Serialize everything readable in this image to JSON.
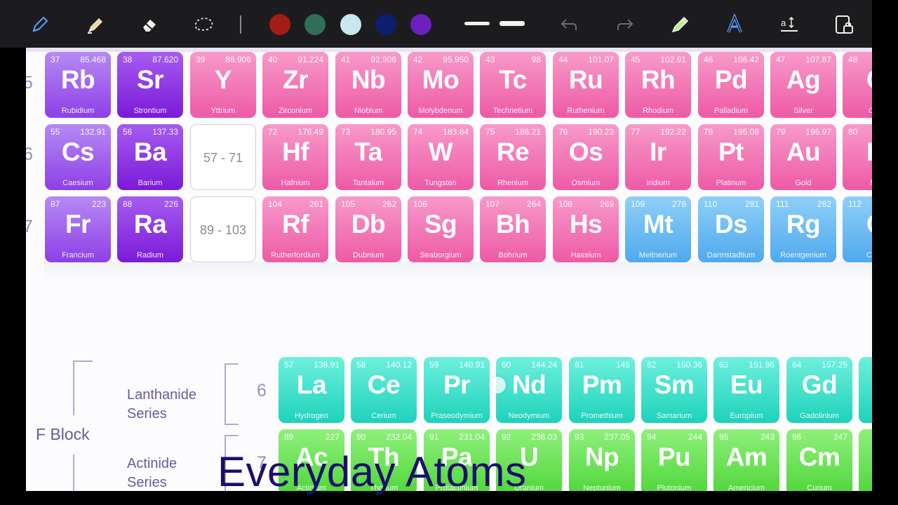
{
  "toolbar": {
    "tools": [
      "pen-icon",
      "highlighter-icon",
      "eraser-icon",
      "lasso-icon"
    ],
    "colors": [
      "#a31c16",
      "#2f6e58",
      "#c9e7f3",
      "#0b1f6e",
      "#6b1fbf"
    ],
    "right_tools": [
      "undo-icon",
      "redo-icon",
      "pencil-icon",
      "text-style-icon",
      "text-size-icon",
      "lock-icon"
    ]
  },
  "periods": {
    "p5": "5",
    "p6": "6",
    "p7": "7",
    "p6f": "6",
    "p7f": "7"
  },
  "labels": {
    "lanthanide": [
      "Lanthanide",
      "Series"
    ],
    "actinide": [
      "Actinide",
      "Series"
    ],
    "fblock": "F Block"
  },
  "rows": [
    [
      {
        "n": "37",
        "m": "85.468",
        "s": "Rb",
        "name": "Rubidium",
        "c": "purple1"
      },
      {
        "n": "38",
        "m": "87.620",
        "s": "Sr",
        "name": "Strontium",
        "c": "purple2"
      },
      {
        "n": "39",
        "m": "88.906",
        "s": "Y",
        "name": "Yttrium",
        "c": "pink"
      },
      {
        "n": "40",
        "m": "91.224",
        "s": "Zr",
        "name": "Zirconium",
        "c": "pink"
      },
      {
        "n": "41",
        "m": "92.906",
        "s": "Nb",
        "name": "Niobium",
        "c": "pink"
      },
      {
        "n": "42",
        "m": "95.950",
        "s": "Mo",
        "name": "Molybdenum",
        "c": "pink"
      },
      {
        "n": "43",
        "m": "98",
        "s": "Tc",
        "name": "Technetium",
        "c": "pink"
      },
      {
        "n": "44",
        "m": "101.07",
        "s": "Ru",
        "name": "Ruthenium",
        "c": "pink"
      },
      {
        "n": "45",
        "m": "102.91",
        "s": "Rh",
        "name": "Rhodium",
        "c": "pink"
      },
      {
        "n": "46",
        "m": "106.42",
        "s": "Pd",
        "name": "Palladium",
        "c": "pink"
      },
      {
        "n": "47",
        "m": "107.87",
        "s": "Ag",
        "name": "Silver",
        "c": "pink"
      },
      {
        "n": "48",
        "m": "",
        "s": "C",
        "name": "Cad",
        "c": "pink"
      }
    ],
    [
      {
        "n": "55",
        "m": "132.91",
        "s": "Cs",
        "name": "Caesium",
        "c": "purple1"
      },
      {
        "n": "56",
        "m": "137.33",
        "s": "Ba",
        "name": "Barium",
        "c": "purple2"
      },
      {
        "range": "57 - 71"
      },
      {
        "n": "72",
        "m": "178.49",
        "s": "Hf",
        "name": "Hafnium",
        "c": "pink"
      },
      {
        "n": "73",
        "m": "180.95",
        "s": "Ta",
        "name": "Tantalum",
        "c": "pink"
      },
      {
        "n": "74",
        "m": "183.84",
        "s": "W",
        "name": "Tungsten",
        "c": "pink"
      },
      {
        "n": "75",
        "m": "186.21",
        "s": "Re",
        "name": "Rhenium",
        "c": "pink"
      },
      {
        "n": "76",
        "m": "190.23",
        "s": "Os",
        "name": "Osmium",
        "c": "pink"
      },
      {
        "n": "77",
        "m": "192.22",
        "s": "Ir",
        "name": "Iridium",
        "c": "pink"
      },
      {
        "n": "78",
        "m": "195.08",
        "s": "Pt",
        "name": "Platinum",
        "c": "pink"
      },
      {
        "n": "79",
        "m": "196.97",
        "s": "Au",
        "name": "Gold",
        "c": "pink"
      },
      {
        "n": "80",
        "m": "",
        "s": "H",
        "name": "Me",
        "c": "pink"
      }
    ],
    [
      {
        "n": "87",
        "m": "223",
        "s": "Fr",
        "name": "Francium",
        "c": "purple1"
      },
      {
        "n": "88",
        "m": "226",
        "s": "Ra",
        "name": "Radium",
        "c": "purple2"
      },
      {
        "range": "89 - 103"
      },
      {
        "n": "104",
        "m": "261",
        "s": "Rf",
        "name": "Rutherfordium",
        "c": "pink"
      },
      {
        "n": "105",
        "m": "262",
        "s": "Db",
        "name": "Dubnium",
        "c": "pink"
      },
      {
        "n": "106",
        "m": "",
        "s": "Sg",
        "name": "Seaborgium",
        "c": "pink"
      },
      {
        "n": "107",
        "m": "264",
        "s": "Bh",
        "name": "Bohrium",
        "c": "pink"
      },
      {
        "n": "108",
        "m": "269",
        "s": "Hs",
        "name": "Hassium",
        "c": "pink"
      },
      {
        "n": "109",
        "m": "278",
        "s": "Mt",
        "name": "Meitnerium",
        "c": "blue"
      },
      {
        "n": "110",
        "m": "281",
        "s": "Ds",
        "name": "Darmstadtium",
        "c": "blue"
      },
      {
        "n": "111",
        "m": "282",
        "s": "Rg",
        "name": "Roentgenium",
        "c": "blue"
      },
      {
        "n": "112",
        "m": "",
        "s": "C",
        "name": "Cope",
        "c": "blue"
      }
    ]
  ],
  "lanthanides": [
    {
      "n": "57",
      "m": "138.91",
      "s": "La",
      "name": "Hydrogen"
    },
    {
      "n": "58",
      "m": "140.12",
      "s": "Ce",
      "name": "Cerium"
    },
    {
      "n": "59",
      "m": "140.91",
      "s": "Pr",
      "name": "Praseodymium"
    },
    {
      "n": "60",
      "m": "144.24",
      "s": "Nd",
      "name": "Neodymium"
    },
    {
      "n": "61",
      "m": "145",
      "s": "Pm",
      "name": "Promethium"
    },
    {
      "n": "62",
      "m": "150.36",
      "s": "Sm",
      "name": "Samarium"
    },
    {
      "n": "63",
      "m": "151.96",
      "s": "Eu",
      "name": "Europium"
    },
    {
      "n": "64",
      "m": "157.25",
      "s": "Gd",
      "name": "Gadolinium"
    },
    {
      "n": "",
      "m": "",
      "s": "",
      "name": ""
    }
  ],
  "actinides": [
    {
      "n": "89",
      "m": "227",
      "s": "Ac",
      "name": "Actinium"
    },
    {
      "n": "90",
      "m": "232.04",
      "s": "Th",
      "name": "Thorium"
    },
    {
      "n": "91",
      "m": "231.04",
      "s": "Pa",
      "name": "Protactinium"
    },
    {
      "n": "92",
      "m": "238.03",
      "s": "U",
      "name": "Uranium"
    },
    {
      "n": "93",
      "m": "237.05",
      "s": "Np",
      "name": "Neptunium"
    },
    {
      "n": "94",
      "m": "244",
      "s": "Pu",
      "name": "Plutonium"
    },
    {
      "n": "95",
      "m": "243",
      "s": "Am",
      "name": "Americium"
    },
    {
      "n": "96",
      "m": "247",
      "s": "Cm",
      "name": "Curium"
    },
    {
      "n": "",
      "m": "",
      "s": "",
      "name": ""
    }
  ],
  "watermark": "Everyday Atoms"
}
